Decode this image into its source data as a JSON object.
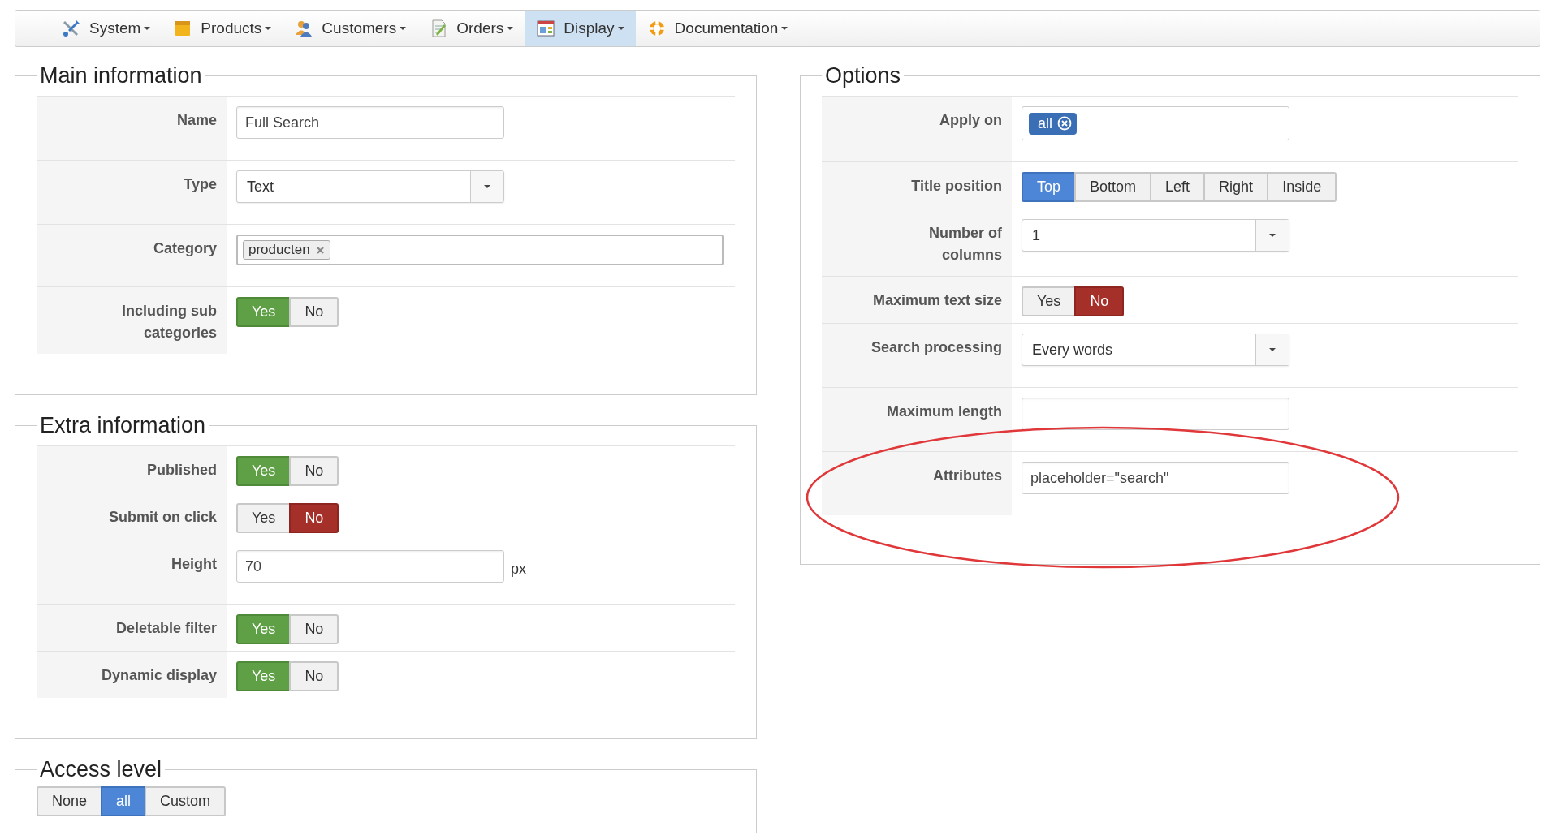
{
  "menu": [
    {
      "label": "System",
      "selected": false
    },
    {
      "label": "Products",
      "selected": false
    },
    {
      "label": "Customers",
      "selected": false
    },
    {
      "label": "Orders",
      "selected": false
    },
    {
      "label": "Display",
      "selected": true
    },
    {
      "label": "Documentation",
      "selected": false
    }
  ],
  "main_information": {
    "legend": "Main information",
    "rows": [
      {
        "label": "Name",
        "kind": "text",
        "value": "Full Search"
      },
      {
        "label": "Type",
        "kind": "select",
        "value": "Text"
      },
      {
        "label": "Category",
        "kind": "tags",
        "tags": [
          "producten"
        ]
      },
      {
        "label": "Including sub categories",
        "kind": "toggle",
        "options": [
          {
            "label": "Yes",
            "selected": true
          },
          {
            "label": "No",
            "selected": false
          }
        ]
      }
    ]
  },
  "extra_information": {
    "legend": "Extra information",
    "rows": [
      {
        "label": "Published",
        "kind": "toggle",
        "options": [
          {
            "label": "Yes",
            "selected": true
          },
          {
            "label": "No",
            "selected": false
          }
        ]
      },
      {
        "label": "Submit on click",
        "kind": "toggle",
        "options": [
          {
            "label": "Yes",
            "selected": false
          },
          {
            "label": "No",
            "selected": true
          }
        ]
      },
      {
        "label": "Height",
        "kind": "text",
        "value": "70",
        "suffix": "px"
      },
      {
        "label": "Deletable filter",
        "kind": "toggle",
        "options": [
          {
            "label": "Yes",
            "selected": true
          },
          {
            "label": "No",
            "selected": false
          }
        ]
      },
      {
        "label": "Dynamic display",
        "kind": "toggle",
        "options": [
          {
            "label": "Yes",
            "selected": true
          },
          {
            "label": "No",
            "selected": false
          }
        ]
      }
    ]
  },
  "access_level": {
    "legend": "Access level",
    "options": [
      {
        "label": "None",
        "selected": false
      },
      {
        "label": "all",
        "selected": true
      },
      {
        "label": "Custom",
        "selected": false
      }
    ]
  },
  "options": {
    "legend": "Options",
    "rows": [
      {
        "label": "Apply on",
        "kind": "chips",
        "tags": [
          "all"
        ]
      },
      {
        "label": "Title position",
        "kind": "segmented",
        "options": [
          {
            "label": "Top",
            "selected": true
          },
          {
            "label": "Bottom",
            "selected": false
          },
          {
            "label": "Left",
            "selected": false
          },
          {
            "label": "Right",
            "selected": false
          },
          {
            "label": "Inside",
            "selected": false
          }
        ]
      },
      {
        "label": "Number of columns",
        "kind": "select",
        "value": "1"
      },
      {
        "label": "Maximum text size",
        "kind": "toggle",
        "options": [
          {
            "label": "Yes",
            "selected": false
          },
          {
            "label": "No",
            "selected": true
          }
        ]
      },
      {
        "label": "Search processing",
        "kind": "select",
        "value": "Every words"
      },
      {
        "label": "Maximum length",
        "kind": "text"
      },
      {
        "label": "Attributes",
        "kind": "text",
        "value": "placeholder=\"search\"",
        "highlighted": true
      }
    ]
  }
}
